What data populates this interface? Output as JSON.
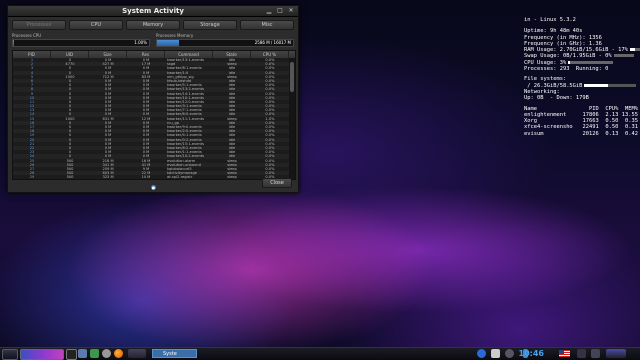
{
  "window": {
    "title": "System Activity",
    "tabs": [
      "Processes",
      "CPU",
      "Memory",
      "Storage",
      "Misc"
    ],
    "cpu_label": "Processes CPU",
    "cpu_value": "1.00%",
    "cpu_fraction": 0.01,
    "mem_label": "Processes Memory",
    "mem_value": "2586 M / 16017 M",
    "mem_fraction": 0.16,
    "columns": [
      "PID",
      "UID",
      "Size",
      "Res",
      "Command",
      "State",
      "CPU %"
    ],
    "close_label": "Close",
    "rows": [
      [
        "1",
        "0",
        "0 M",
        "0 M",
        "kworker/13:1-events",
        "idle",
        "0.0%"
      ],
      [
        "2",
        "4770",
        "427 M",
        "17 M",
        "ssgd",
        "sleep",
        "0.0%"
      ],
      [
        "3",
        "0",
        "0 M",
        "0 M",
        "kworker/8:1-events",
        "idle",
        "0.0%"
      ],
      [
        "4",
        "0",
        "0 M",
        "0 M",
        "kworker/1:0",
        "idle",
        "0.0%"
      ],
      [
        "5",
        "1000",
        "712 M",
        "83 M",
        "xim_gtkipp_sig",
        "sleep",
        "0.0%"
      ],
      [
        "6",
        "0",
        "0 M",
        "0 M",
        "kfsub-kdshdd",
        "idle",
        "0.0%"
      ],
      [
        "7",
        "0",
        "0 M",
        "0 M",
        "kworker/5:1-events",
        "idle",
        "0.0%"
      ],
      [
        "8",
        "0",
        "0 M",
        "0 M",
        "kworker/13:2-events",
        "idle",
        "0.0%"
      ],
      [
        "9",
        "0",
        "0 M",
        "0 M",
        "kworker/14:1-events",
        "idle",
        "0.0%"
      ],
      [
        "10",
        "0",
        "0 M",
        "0 M",
        "kworker/10:1-events",
        "idle",
        "0.0%"
      ],
      [
        "11",
        "0",
        "0 M",
        "0 M",
        "kworker/12:0-events",
        "idle",
        "0.0%"
      ],
      [
        "12",
        "0",
        "0 M",
        "0 M",
        "kworker/3:1-events",
        "idle",
        "0.0%"
      ],
      [
        "13",
        "0",
        "0 M",
        "0 M",
        "kworker/7:1-events",
        "idle",
        "0.0%"
      ],
      [
        "14",
        "0",
        "0 M",
        "0 M",
        "kworker/6:0-events",
        "idle",
        "0.0%"
      ],
      [
        "15",
        "1000",
        "631 M",
        "12 M",
        "kworker/11:1-events",
        "sleep",
        "1.0%"
      ],
      [
        "16",
        "0",
        "0 M",
        "0 M",
        "rcu_gp",
        "idle",
        "0.0%"
      ],
      [
        "17",
        "0",
        "0 M",
        "0 M",
        "kworker/9:0-events",
        "idle",
        "0.0%"
      ],
      [
        "18",
        "0",
        "0 M",
        "0 M",
        "kworker/2:0-events",
        "idle",
        "0.0%"
      ],
      [
        "19",
        "0",
        "0 M",
        "0 M",
        "kworker/4:1-events",
        "idle",
        "0.0%"
      ],
      [
        "20",
        "0",
        "0 M",
        "0 M",
        "kworker/0:2-events",
        "idle",
        "0.0%"
      ],
      [
        "21",
        "0",
        "0 M",
        "0 M",
        "kworker/15:1-events",
        "idle",
        "0.0%"
      ],
      [
        "22",
        "0",
        "0 M",
        "0 M",
        "kworker/8:2-events",
        "idle",
        "0.0%"
      ],
      [
        "23",
        "0",
        "0 M",
        "0 M",
        "kworker/1:1-events",
        "idle",
        "0.0%"
      ],
      [
        "24",
        "0",
        "0 M",
        "0 M",
        "kworker/10:2-events",
        "idle",
        "0.0%"
      ],
      [
        "25",
        "500",
        "218 M",
        "16 M",
        "evolution-alarm",
        "sleep",
        "0.0%"
      ],
      [
        "26",
        "500",
        "341 M",
        "41 M",
        "evolution-unbound",
        "sleep",
        "0.0%"
      ],
      [
        "27",
        "500",
        "259 M",
        "9 M",
        "kglobalaccel5",
        "sleep",
        "0.0%"
      ],
      [
        "28",
        "500",
        "603 M",
        "22 M",
        "kactivitymanage",
        "sleep",
        "0.0%"
      ],
      [
        "29",
        "500",
        "323 M",
        "10 M",
        "at-spi2-registr",
        "sleep",
        "0.0%"
      ],
      [
        "30",
        "500",
        "194 M",
        "14 M",
        "polkit-gnome-au",
        "sleep",
        "0.0%"
      ]
    ]
  },
  "conky": {
    "title": "in - Linux 5.3.2",
    "uptime": "Uptime: 9h 48m 40s",
    "freq_mhz": "Frequency (in MHz): 1356",
    "freq_ghz": "Frequency (in GHz): 1.36",
    "ram": "RAM Usage: 2.70GiB/15.6GiB - 17%",
    "ram_fraction": 0.17,
    "swap": "Swap Usage: 0B/1.95GiB - 0%",
    "swap_fraction": 0.0,
    "cpu": "CPU Usage: 3%",
    "cpu_fraction": 0.03,
    "processes": "Processes: 293  Running: 0",
    "fs_header": "File systems:",
    "fs": " / 26.3GiB/58.5GiB",
    "fs_fraction": 0.45,
    "net_header": "Networking:",
    "net": "Up: 0B  - Down: 179B",
    "proc_header": [
      "Name",
      "PID",
      "CPU%",
      "MEM%"
    ],
    "procs": [
      [
        "enlightenment",
        "17806",
        "2.13",
        "13.55"
      ],
      [
        "Xorg",
        "17663",
        "0.50",
        "0.35"
      ],
      [
        "xfce4-screensho",
        "22491",
        "0.50",
        "0.31"
      ],
      [
        "evisum",
        "20126",
        "0.13",
        "0.42"
      ]
    ]
  },
  "taskbar": {
    "task_label": "Syste",
    "clock": "10:46"
  },
  "colors": {
    "accent": "#3b6ea8",
    "meter_fill": "#2860a8",
    "pid_text": "#6a9ad8"
  }
}
